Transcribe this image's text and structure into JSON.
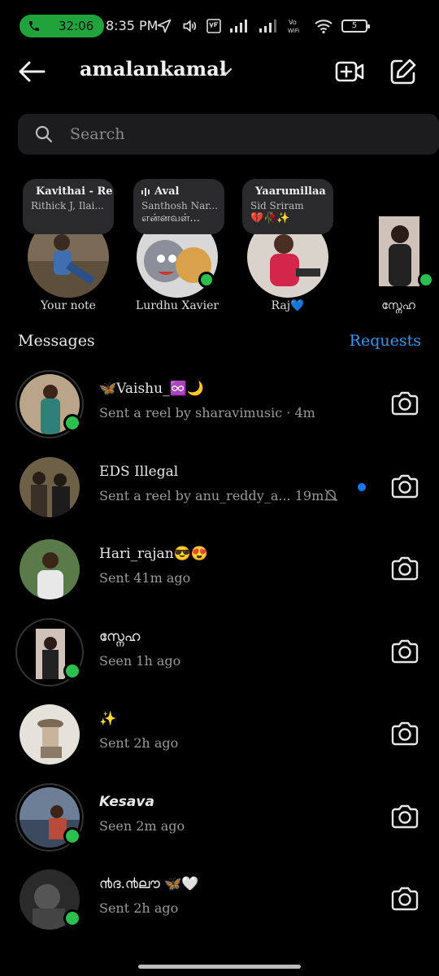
{
  "status_bar": {
    "call_timer": "32:06",
    "time": "8:35 PM",
    "battery": "5"
  },
  "header": {
    "account": "amalankamal"
  },
  "search": {
    "placeholder": "Search"
  },
  "notes": [
    {
      "song": "Kavithai - Re",
      "artist": "Rithick J, Ilai...",
      "extra": "",
      "name": "Your note"
    },
    {
      "song": "Aval",
      "artist": "Santhosh Nar...",
      "extra": "என்னவள்...",
      "name": "Lurdhu Xavier"
    },
    {
      "song": "Yaarumillaa",
      "artist": "Sid Sriram",
      "extra": "💔🥀✨",
      "name": "Raj💙"
    },
    {
      "song": "",
      "artist": "",
      "extra": "",
      "name": "സ്നേഹ"
    }
  ],
  "messages_title": "Messages",
  "requests_label": "Requests",
  "threads": [
    {
      "name": "🦋Vaishu_♾️🌙",
      "sub": "Sent a reel by sharavimusic · 4m",
      "online": true,
      "ring": true,
      "unread": false,
      "muted": false
    },
    {
      "name": "EDS Illegal",
      "sub": "Sent a reel by anu_reddy_a... 19m",
      "online": false,
      "ring": false,
      "unread": true,
      "muted": true
    },
    {
      "name": "Hari_rajan😎😍",
      "sub": "Sent 41m ago",
      "online": false,
      "ring": false,
      "unread": false,
      "muted": false
    },
    {
      "name": "സ്നേഹ",
      "sub": "Seen 1h ago",
      "online": true,
      "ring": true,
      "unread": false,
      "muted": false
    },
    {
      "name": "✨",
      "sub": "Sent 2h ago",
      "online": false,
      "ring": false,
      "unread": false,
      "muted": false
    },
    {
      "name": "Kesava",
      "sub": "Seen 2m ago",
      "online": true,
      "ring": true,
      "unread": false,
      "muted": false
    },
    {
      "name": "൯ദ.൯ലൗ 🦋🤍",
      "sub": "Sent 2h ago",
      "online": true,
      "ring": false,
      "unread": false,
      "muted": false
    }
  ]
}
